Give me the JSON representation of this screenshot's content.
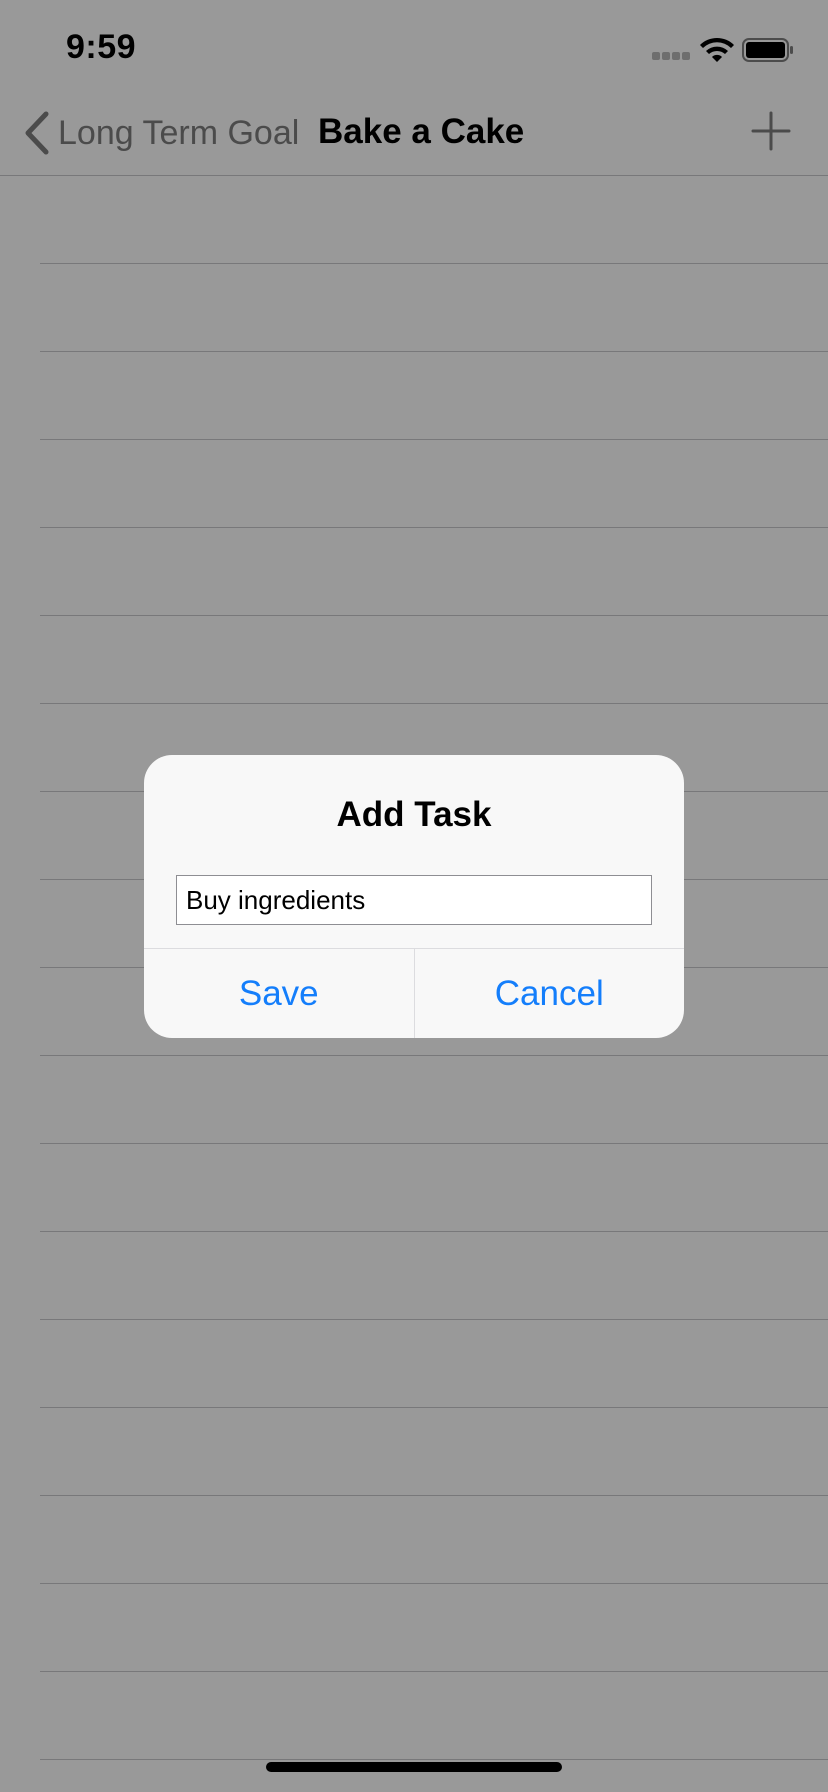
{
  "status_bar": {
    "time": "9:59"
  },
  "nav": {
    "back_label": "Long Term Goal",
    "title": "Bake a Cake",
    "add_icon": "plus-icon"
  },
  "list": {
    "row_count": 18
  },
  "alert": {
    "title": "Add Task",
    "input_value": "Buy ingredients",
    "save_label": "Save",
    "cancel_label": "Cancel"
  },
  "colors": {
    "accent": "#147efb",
    "overlay": "rgba(0,0,0,0.40)"
  }
}
